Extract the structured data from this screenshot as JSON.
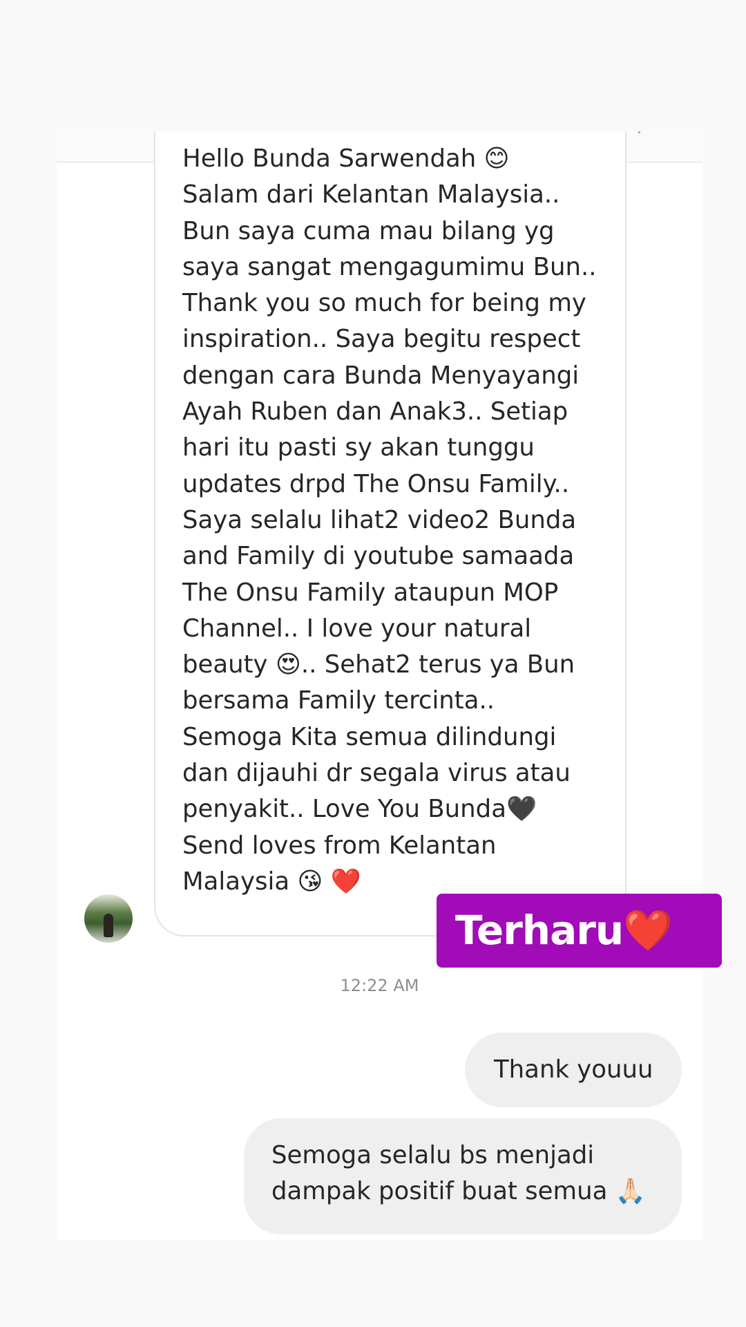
{
  "conversation": {
    "incoming_message": "Hello Bunda Sarwendah 😊\nSalam dari Kelantan Malaysia..\nBun saya cuma mau bilang yg\nsaya sangat mengagumimu Bun..\nThank you so much for being my\ninspiration.. Saya begitu respect\ndengan cara Bunda Menyayangi\nAyah Ruben dan Anak3.. Setiap\nhari itu pasti sy akan tunggu\nupdates drpd The Onsu Family..\nSaya selalu lihat2 video2 Bunda\nand Family di youtube samaada\nThe Onsu Family ataupun MOP\nChannel.. I love your natural\nbeauty 😍.. Sehat2 terus ya Bun\nbersama Family tercinta..\nSemoga Kita semua dilindungi\ndan dijauhi dr segala virus atau\npenyakit.. Love You Bunda🖤\nSend loves from Kelantan\nMalaysia 😘 ❤️",
    "timestamp": "12:22 AM",
    "outgoing_messages": [
      "Thank youuu",
      "Semoga selalu bs menjadi\ndampak positif buat semua 🙏🏻"
    ]
  },
  "sticker": {
    "text": "Terharu❤️",
    "background_color": "#a10bb8",
    "text_color": "#ffffff"
  }
}
